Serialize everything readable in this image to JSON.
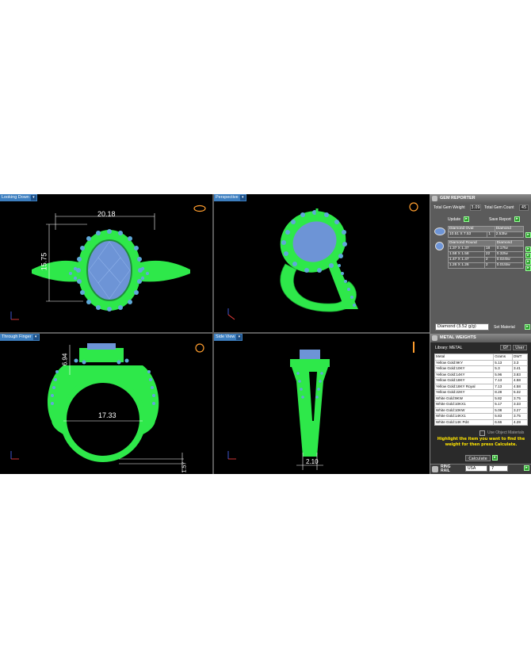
{
  "viewports": {
    "top_left": {
      "label": "Looking Down",
      "dims": [
        "20.18",
        "15.75"
      ]
    },
    "top_right": {
      "label": "Perspective"
    },
    "bottom_left": {
      "label": "Through Finger",
      "dims": [
        "6.94",
        "17.33",
        "1.57"
      ]
    },
    "bottom_right": {
      "label": "Side View",
      "dims": [
        "2.10"
      ]
    }
  },
  "gem_reporter": {
    "title": "GEM REPORTER",
    "total_weight_label": "Total Gem Weight",
    "total_weight_value": "3.09",
    "total_count_label": "Total Gem Count",
    "total_count_value": "45",
    "update_label": "Update",
    "save_report_label": "Save Report",
    "groups": [
      {
        "header": [
          "Diamond Oval",
          "Diamond"
        ],
        "rows": [
          [
            "10.51 X 7.53",
            "1",
            "2.53tw"
          ]
        ]
      },
      {
        "header": [
          "Diamond Round",
          "Diamond"
        ],
        "rows": [
          [
            "1.37 X 1.37",
            "18",
            "0.17tw"
          ],
          [
            "1.58 X 1.58",
            "22",
            "0.32tw"
          ],
          [
            "1.47 X 1.47",
            "2",
            "0.024tw"
          ],
          [
            "1.26 X 1.26",
            "2",
            "0.015tw"
          ]
        ]
      }
    ],
    "material_select": "Diamond  (3.52 g/g)",
    "set_material_label": "Set Material"
  },
  "metal_weights": {
    "title": "METAL WEIGHTS",
    "library_label": "Library: METAL",
    "unit_options": [
      "GY",
      "User"
    ],
    "columns": [
      "Metal",
      "Grams",
      "DWT"
    ],
    "rows": [
      [
        "Yellow Gold:9KY",
        "5.13",
        "3.3"
      ],
      [
        "Yellow Gold:10KY",
        "5.3",
        "3.41"
      ],
      [
        "Yellow Gold:14KY",
        "5.96",
        "3.83"
      ],
      [
        "Yellow Gold:18KY",
        "7.13",
        "4.58"
      ],
      [
        "Yellow Gold:18KY Royal",
        "7.13",
        "4.58"
      ],
      [
        "Yellow Gold:22KY",
        "8.28",
        "5.32"
      ],
      [
        "White Gold:9KW",
        "5.82",
        "3.75"
      ],
      [
        "White Gold:10KX1",
        "5.17",
        "3.33"
      ],
      [
        "White Gold:10KW",
        "5.08",
        "3.27"
      ],
      [
        "White Gold:14KX1",
        "5.83",
        "3.75"
      ],
      [
        "White Gold:14K Pd4",
        "6.66",
        "4.28"
      ]
    ],
    "use_object_materials": "Use Object Materials",
    "hint": "Highlight the item you want to find the weight for then press Calculate.",
    "calculate_label": "Calculate",
    "ring_rail_label": "RING RAIL",
    "country": "USA",
    "size": "7"
  },
  "colors": {
    "metal": "#2ee84a",
    "stone": "#7fa6e0",
    "accent": "#3d7fc0"
  }
}
